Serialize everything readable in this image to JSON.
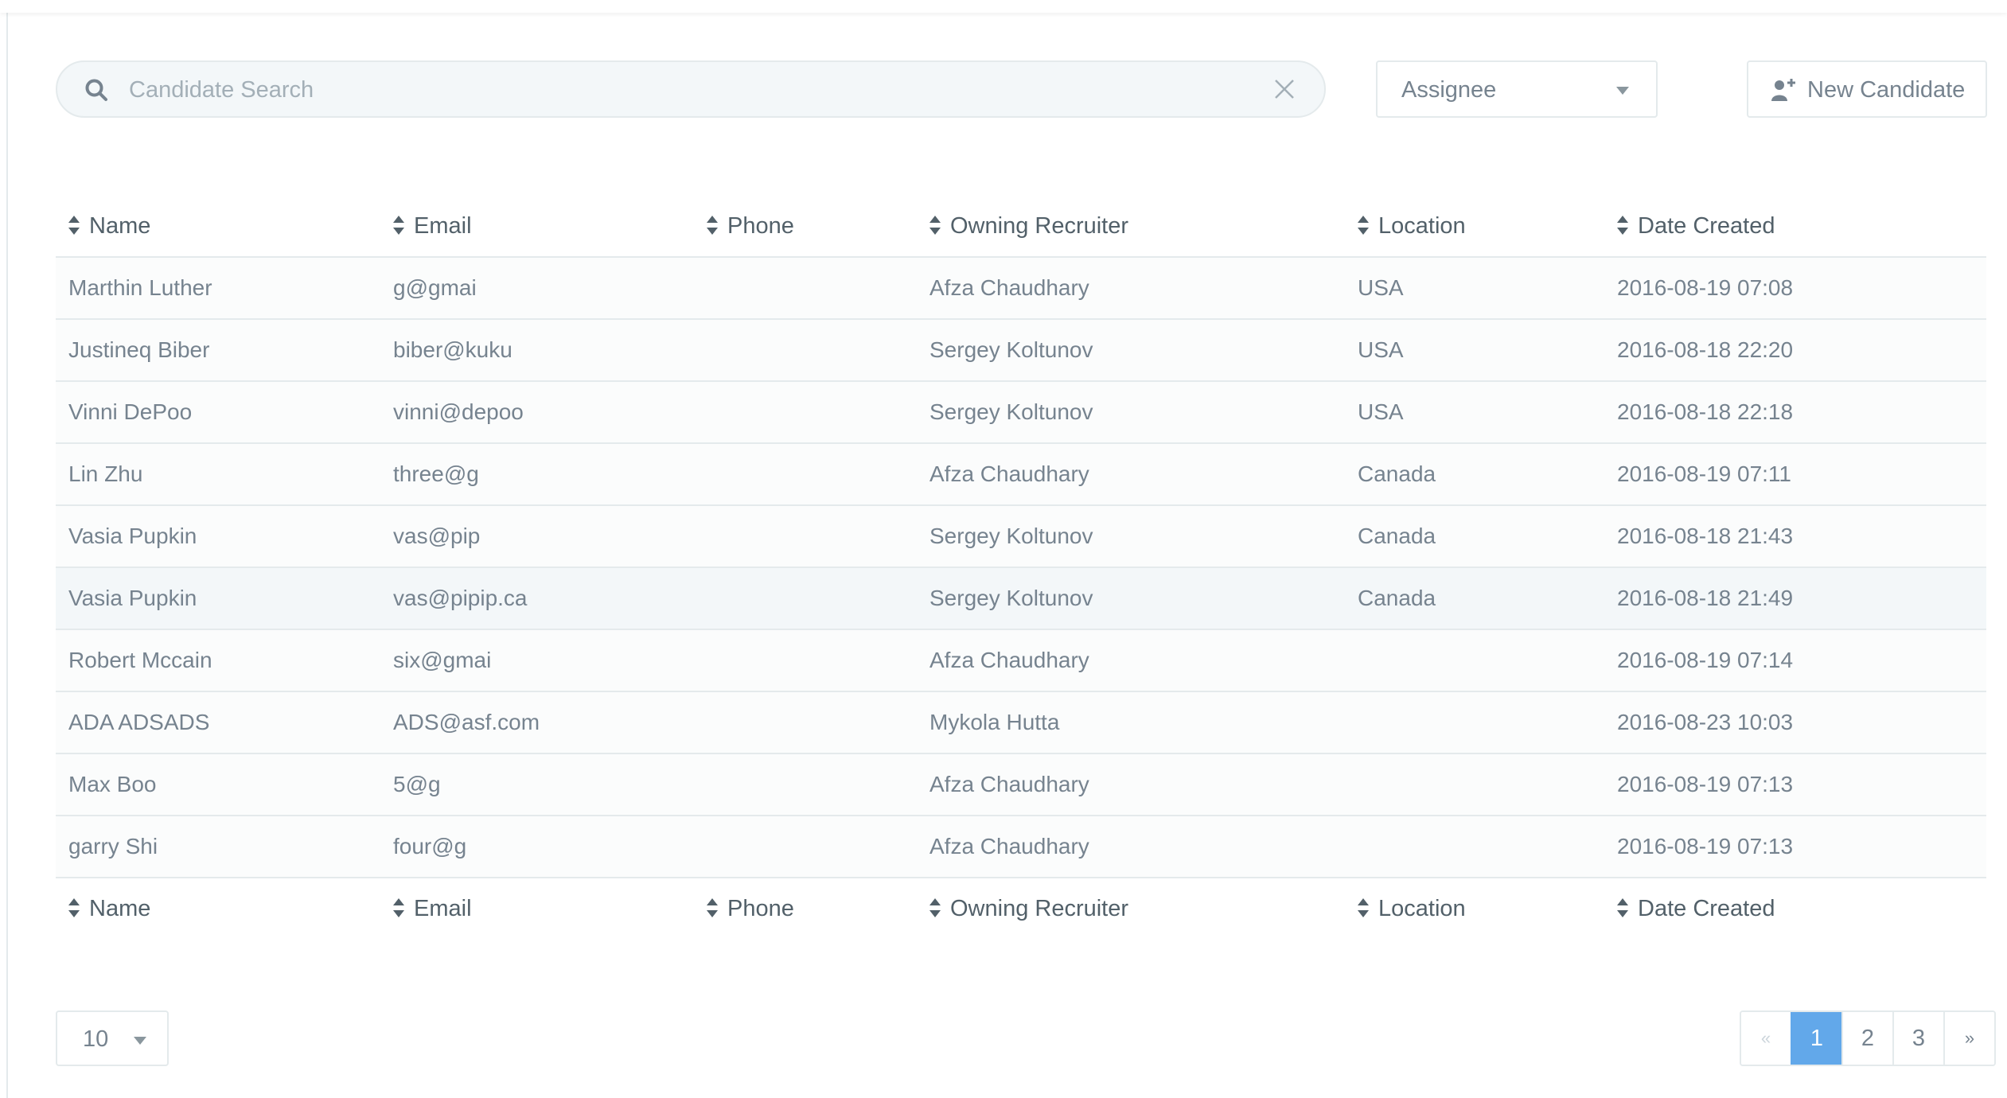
{
  "search": {
    "placeholder": "Candidate Search",
    "value": ""
  },
  "assignee": {
    "label": "Assignee"
  },
  "new_candidate": {
    "label": "New Candidate"
  },
  "table": {
    "columns": [
      "Name",
      "Email",
      "Phone",
      "Owning Recruiter",
      "Location",
      "Date Created"
    ],
    "rows": [
      {
        "name": "Marthin Luther",
        "email": "g@gmai",
        "phone": "",
        "recruiter": "Afza Chaudhary",
        "location": "USA",
        "date": "2016-08-19 07:08"
      },
      {
        "name": "Justineq Biber",
        "email": "biber@kuku",
        "phone": "",
        "recruiter": "Sergey Koltunov",
        "location": "USA",
        "date": "2016-08-18 22:20"
      },
      {
        "name": "Vinni DePoo",
        "email": "vinni@depoo",
        "phone": "",
        "recruiter": "Sergey Koltunov",
        "location": "USA",
        "date": "2016-08-18 22:18"
      },
      {
        "name": "Lin Zhu",
        "email": "three@g",
        "phone": "",
        "recruiter": "Afza Chaudhary",
        "location": "Canada",
        "date": "2016-08-19 07:11"
      },
      {
        "name": "Vasia Pupkin",
        "email": "vas@pip",
        "phone": "",
        "recruiter": "Sergey Koltunov",
        "location": "Canada",
        "date": "2016-08-18 21:43"
      },
      {
        "name": "Vasia Pupkin",
        "email": "vas@pipip.ca",
        "phone": "",
        "recruiter": "Sergey Koltunov",
        "location": "Canada",
        "date": "2016-08-18 21:49"
      },
      {
        "name": "Robert Mccain",
        "email": "six@gmai",
        "phone": "",
        "recruiter": "Afza Chaudhary",
        "location": "",
        "date": "2016-08-19 07:14"
      },
      {
        "name": "ADA ADSADS",
        "email": "ADS@asf.com",
        "phone": "",
        "recruiter": "Mykola Hutta",
        "location": "",
        "date": "2016-08-23 10:03"
      },
      {
        "name": "Max Boo",
        "email": "5@g",
        "phone": "",
        "recruiter": "Afza Chaudhary",
        "location": "",
        "date": "2016-08-19 07:13"
      },
      {
        "name": "garry Shi",
        "email": "four@g",
        "phone": "",
        "recruiter": "Afza Chaudhary",
        "location": "",
        "date": "2016-08-19 07:13"
      }
    ],
    "hovered_row": 5
  },
  "page_size": {
    "value": "10"
  },
  "pagination": {
    "prev": "«",
    "pages": [
      "1",
      "2",
      "3"
    ],
    "active": "1",
    "next": "»"
  },
  "colors": {
    "accent": "#62a8ea",
    "text": "#76838f",
    "header_text": "#526069",
    "border": "#e4eaec"
  }
}
